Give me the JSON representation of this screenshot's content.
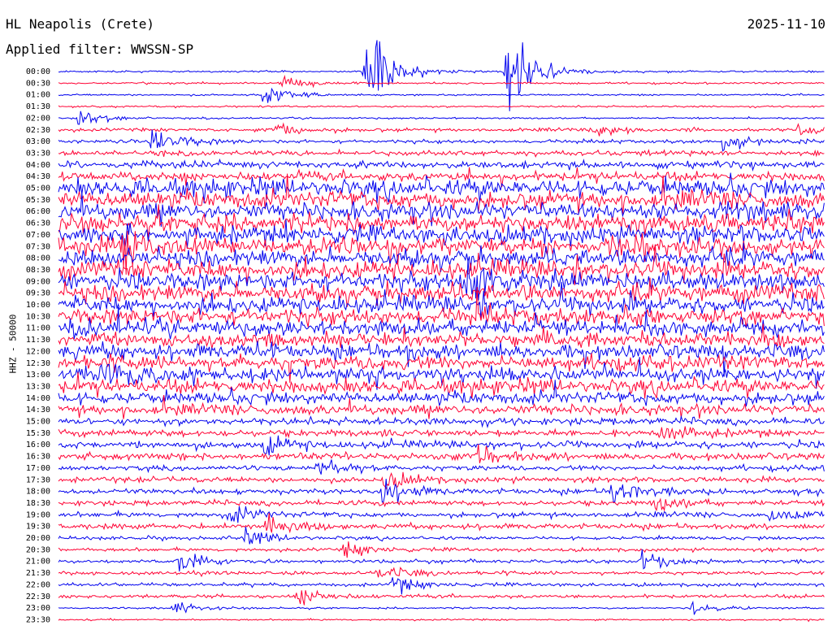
{
  "header": {
    "station": "HL Neapolis (Crete)",
    "date": "2025-11-10",
    "filter": "Applied filter: WWSSN-SP"
  },
  "chart_data": {
    "type": "line",
    "title": "HL Neapolis (Crete)",
    "subtitle": "Applied filter: WWSSN-SP",
    "ylabel": "HHZ - 50000",
    "xlabel": "",
    "grid": false,
    "row_labels": [
      "00:00",
      "00:30",
      "01:00",
      "01:30",
      "02:00",
      "02:30",
      "03:00",
      "03:30",
      "04:00",
      "04:30",
      "05:00",
      "05:30",
      "06:00",
      "06:30",
      "07:00",
      "07:30",
      "08:00",
      "08:30",
      "09:00",
      "09:30",
      "10:00",
      "10:30",
      "11:00",
      "11:30",
      "12:00",
      "12:30",
      "13:00",
      "13:30",
      "14:00",
      "14:30",
      "15:00",
      "15:30",
      "16:00",
      "16:30",
      "17:00",
      "17:30",
      "18:00",
      "18:30",
      "19:00",
      "19:30",
      "20:00",
      "20:30",
      "21:00",
      "21:30",
      "22:00",
      "22:30",
      "23:00",
      "23:30"
    ],
    "series_colors": [
      "#0000ee",
      "#ff0033"
    ],
    "noise_level": [
      1,
      1,
      1,
      1,
      1,
      2,
      2,
      3,
      4,
      5,
      10,
      10,
      10,
      10,
      10,
      10,
      10,
      10,
      10,
      10,
      9,
      9,
      9,
      8,
      8,
      8,
      8,
      8,
      7,
      6,
      4,
      4,
      4,
      4,
      3,
      3,
      3,
      3,
      3,
      3,
      2,
      2,
      2,
      2,
      2,
      2,
      1,
      1
    ],
    "events": [
      {
        "row": 0,
        "minute": 12.0,
        "amplitude": 70
      },
      {
        "row": 0,
        "minute": 17.5,
        "amplitude": 75
      },
      {
        "row": 1,
        "minute": 8.7,
        "amplitude": 14
      },
      {
        "row": 2,
        "minute": 8.0,
        "amplitude": 16
      },
      {
        "row": 4,
        "minute": 0.8,
        "amplitude": 12
      },
      {
        "row": 5,
        "minute": 8.5,
        "amplitude": 12
      },
      {
        "row": 5,
        "minute": 21.0,
        "amplitude": 10
      },
      {
        "row": 5,
        "minute": 29.0,
        "amplitude": 10
      },
      {
        "row": 6,
        "minute": 3.7,
        "amplitude": 22
      },
      {
        "row": 6,
        "minute": 26.0,
        "amplitude": 16
      },
      {
        "row": 15,
        "minute": 2.5,
        "amplitude": 30
      },
      {
        "row": 18,
        "minute": 16.0,
        "amplitude": 25
      },
      {
        "row": 26,
        "minute": 1.7,
        "amplitude": 25
      },
      {
        "row": 31,
        "minute": 23.5,
        "amplitude": 18
      },
      {
        "row": 32,
        "minute": 8.0,
        "amplitude": 14
      },
      {
        "row": 33,
        "minute": 16.4,
        "amplitude": 14
      },
      {
        "row": 34,
        "minute": 10.2,
        "amplitude": 18
      },
      {
        "row": 35,
        "minute": 12.8,
        "amplitude": 14
      },
      {
        "row": 36,
        "minute": 12.7,
        "amplitude": 18
      },
      {
        "row": 36,
        "minute": 21.7,
        "amplitude": 20
      },
      {
        "row": 37,
        "minute": 23.4,
        "amplitude": 12
      },
      {
        "row": 38,
        "minute": 6.7,
        "amplitude": 12
      },
      {
        "row": 38,
        "minute": 27.8,
        "amplitude": 12
      },
      {
        "row": 39,
        "minute": 8.1,
        "amplitude": 16
      },
      {
        "row": 40,
        "minute": 7.2,
        "amplitude": 14
      },
      {
        "row": 41,
        "minute": 11.2,
        "amplitude": 12
      },
      {
        "row": 42,
        "minute": 4.7,
        "amplitude": 14
      },
      {
        "row": 42,
        "minute": 22.8,
        "amplitude": 14
      },
      {
        "row": 43,
        "minute": 12.4,
        "amplitude": 14
      },
      {
        "row": 44,
        "minute": 13.1,
        "amplitude": 12
      },
      {
        "row": 45,
        "minute": 9.4,
        "amplitude": 14
      },
      {
        "row": 46,
        "minute": 4.5,
        "amplitude": 8
      },
      {
        "row": 46,
        "minute": 24.8,
        "amplitude": 10
      }
    ]
  }
}
